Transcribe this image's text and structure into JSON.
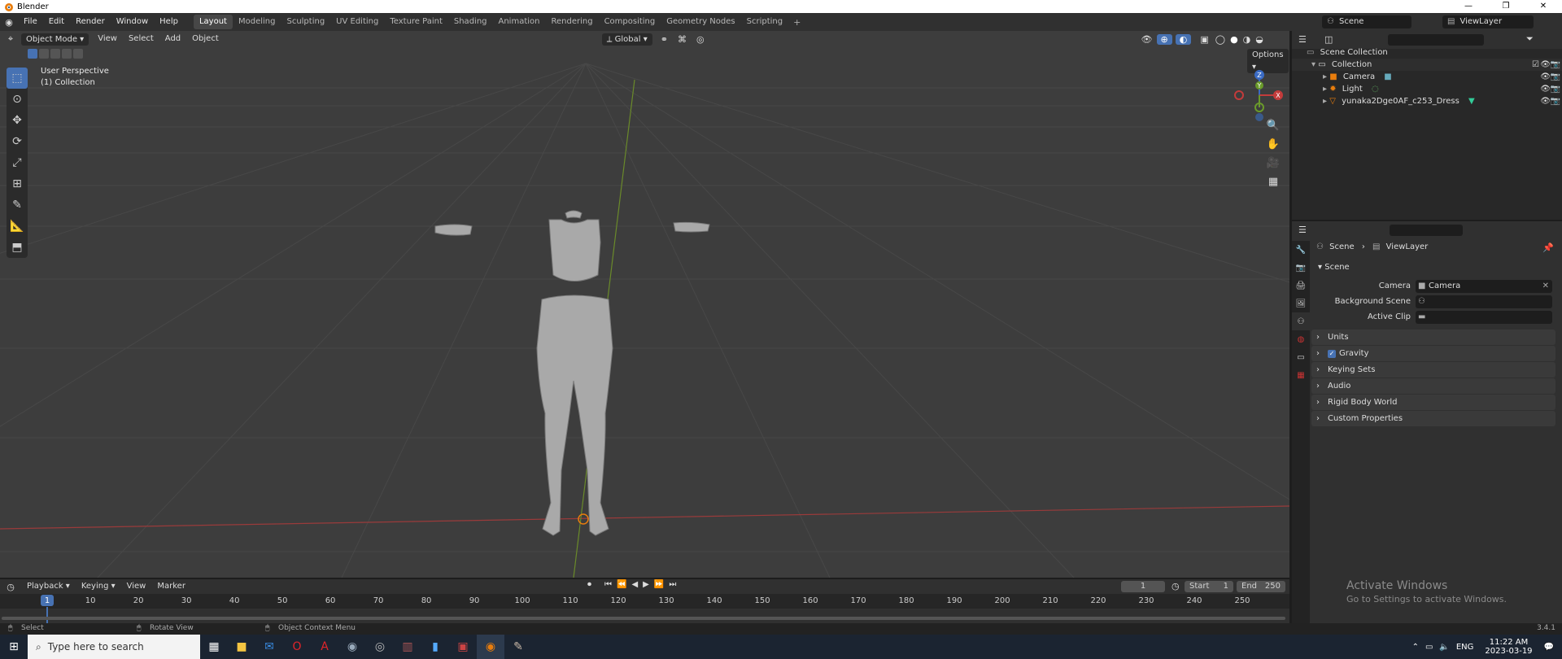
{
  "window": {
    "title": "Blender"
  },
  "menus": [
    "File",
    "Edit",
    "Render",
    "Window",
    "Help"
  ],
  "workspaces": [
    "Layout",
    "Modeling",
    "Sculpting",
    "UV Editing",
    "Texture Paint",
    "Shading",
    "Animation",
    "Rendering",
    "Compositing",
    "Geometry Nodes",
    "Scripting"
  ],
  "active_workspace": "Layout",
  "scene_selector": "Scene",
  "viewlayer_selector": "ViewLayer",
  "viewport": {
    "mode": "Object Mode",
    "menu": [
      "View",
      "Select",
      "Add",
      "Object"
    ],
    "orientation": "Global",
    "options_label": "Options",
    "perspective_label": "User Perspective",
    "collection_label": "(1) Collection",
    "gizmo": {
      "x": "X",
      "y": "Y",
      "z": "Z"
    }
  },
  "outliner": {
    "root": "Scene Collection",
    "collection": "Collection",
    "items": [
      "Camera",
      "Light",
      "yunaka2Dge0AF_c253_Dress"
    ]
  },
  "properties": {
    "breadcrumb": {
      "scene": "Scene",
      "viewlayer": "ViewLayer"
    },
    "section": "Scene",
    "fields": [
      {
        "label": "Camera",
        "value": "Camera"
      },
      {
        "label": "Background Scene",
        "value": ""
      },
      {
        "label": "Active Clip",
        "value": ""
      }
    ],
    "panels": [
      "Units",
      "Gravity",
      "Keying Sets",
      "Audio",
      "Rigid Body World",
      "Custom Properties"
    ],
    "gravity_checked": true
  },
  "timeline": {
    "menu": [
      "Playback",
      "Keying",
      "View",
      "Marker"
    ],
    "current_frame": "1",
    "start_label": "Start",
    "start": "1",
    "end_label": "End",
    "end": "250",
    "ruler": [
      "1",
      "10",
      "20",
      "30",
      "40",
      "50",
      "60",
      "70",
      "80",
      "90",
      "100",
      "110",
      "120",
      "130",
      "140",
      "150",
      "160",
      "170",
      "180",
      "190",
      "200",
      "210",
      "220",
      "230",
      "240",
      "250"
    ]
  },
  "status": {
    "select": "Select",
    "rotate": "Rotate View",
    "context": "Object Context Menu",
    "version": "3.4.1"
  },
  "watermark": {
    "line1": "Activate Windows",
    "line2": "Go to Settings to activate Windows."
  },
  "taskbar": {
    "search_placeholder": "Type here to search",
    "lang": "ENG",
    "time": "11:22 AM",
    "date": "2023-03-19"
  }
}
